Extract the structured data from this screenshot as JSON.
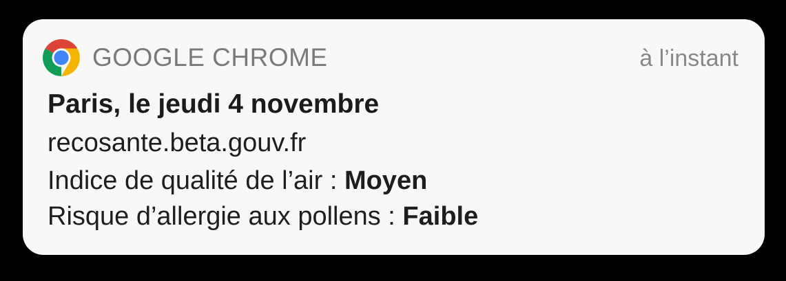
{
  "notification": {
    "app_name": "GOOGLE CHROME",
    "app_icon": "chrome-logo-icon",
    "timestamp": "à l’instant",
    "title": "Paris, le jeudi 4 novembre",
    "source": "recosante.beta.gouv.fr",
    "air_quality": {
      "label": "Indice de qualité de l’air : ",
      "value": "Moyen"
    },
    "pollen_risk": {
      "label": "Risque d’allergie aux pollens : ",
      "value": "Faible"
    }
  },
  "colors": {
    "background": "#000000",
    "card": "#f8f8f8",
    "chrome_red": "#db4437",
    "chrome_yellow": "#f4b400",
    "chrome_green": "#0f9d58",
    "chrome_blue": "#4285f4"
  }
}
